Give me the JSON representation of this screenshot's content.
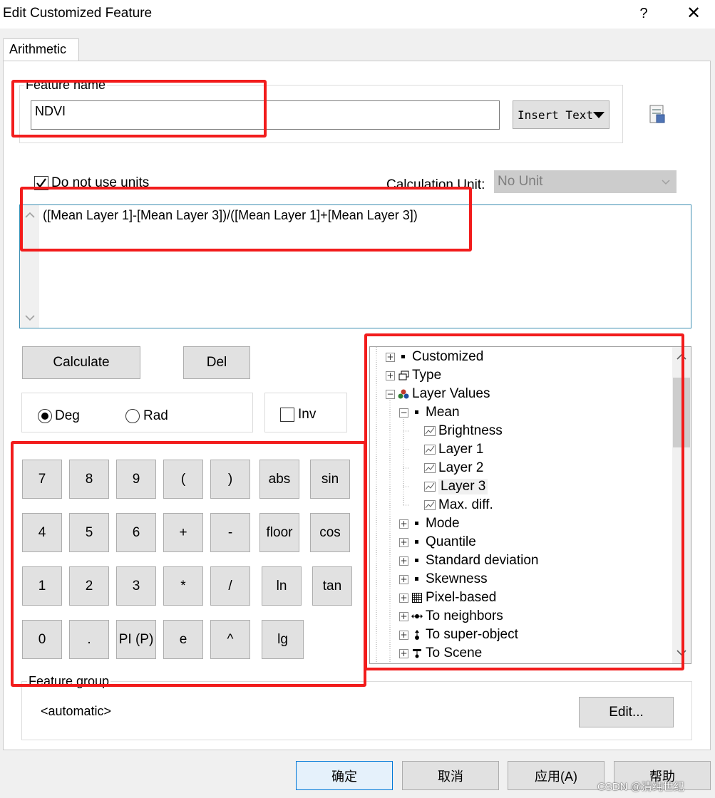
{
  "window": {
    "title": "Edit Customized Feature",
    "help": "?",
    "close": "✕"
  },
  "tab": {
    "label": "Arithmetic"
  },
  "feature_name": {
    "label": "Feature name",
    "value": "NDVI",
    "insert_text": "Insert Text"
  },
  "units": {
    "do_not_use_units_label": "Do not use units",
    "do_not_use_units_checked": true,
    "calc_unit_label": "Calculation Unit:",
    "calc_unit_value": "No Unit"
  },
  "formula": {
    "text": "([Mean Layer 1]-[Mean Layer 3])/([Mean Layer 1]+[Mean Layer 3])"
  },
  "actions": {
    "calculate": "Calculate",
    "del": "Del"
  },
  "angle": {
    "deg": "Deg",
    "rad": "Rad",
    "selected": "Deg",
    "inv": "Inv",
    "inv_checked": false
  },
  "keypad": {
    "row1": [
      "7",
      "8",
      "9",
      "(",
      ")",
      "abs",
      "sin"
    ],
    "row2": [
      "4",
      "5",
      "6",
      "+",
      "-",
      "floor",
      "cos"
    ],
    "row3": [
      "1",
      "2",
      "3",
      "*",
      "/",
      "ln",
      "tan"
    ],
    "row4": [
      "0",
      ".",
      "PI (P)",
      "e",
      "^",
      "lg"
    ]
  },
  "tree": {
    "customized": "Customized",
    "type": "Type",
    "layer_values": "Layer Values",
    "mean": "Mean",
    "brightness": "Brightness",
    "layer1": "Layer 1",
    "layer2": "Layer 2",
    "layer3": "Layer 3",
    "maxdiff": "Max. diff.",
    "mode": "Mode",
    "quantile": "Quantile",
    "stddev": "Standard deviation",
    "skewness": "Skewness",
    "pixel_based": "Pixel-based",
    "to_neighbors": "To neighbors",
    "to_super_object": "To super-object",
    "to_scene": "To Scene"
  },
  "feature_group": {
    "label": "Feature group",
    "value": "<automatic>",
    "edit": "Edit..."
  },
  "footer": {
    "ok": "确定",
    "cancel": "取消",
    "apply": "应用(A)",
    "help": "帮助"
  },
  "watermark": "CSDN @清纯世纪",
  "colors": {
    "annotation_red": "#f21c1c",
    "editor_border": "#3c8eb2",
    "ok_button": "#e5f1fb",
    "ok_border": "#0078d7"
  }
}
